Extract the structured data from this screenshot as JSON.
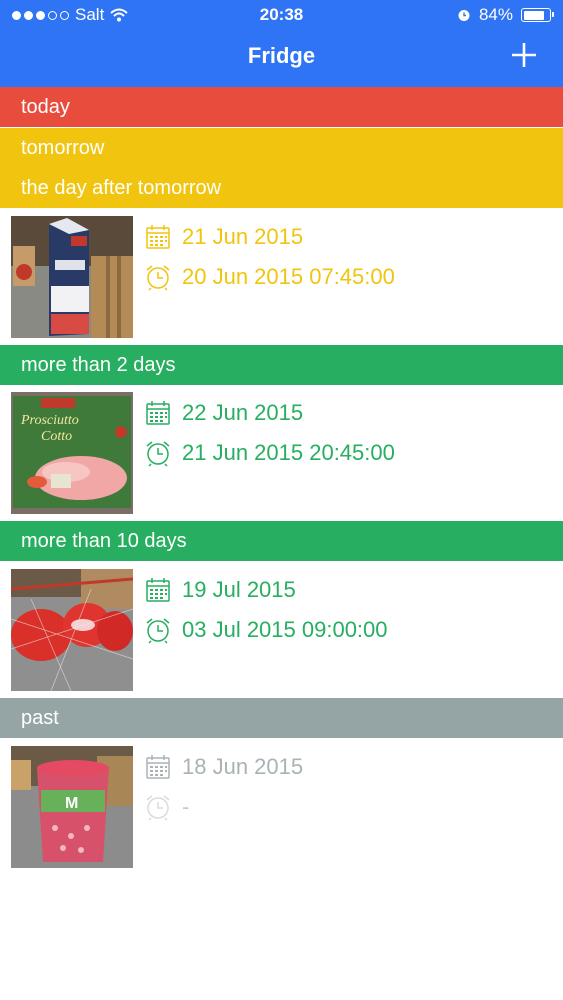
{
  "status_bar": {
    "carrier": "Salt",
    "time": "20:38",
    "battery": "84%",
    "battery_level": 0.84
  },
  "nav": {
    "title": "Fridge",
    "add_icon": "plus-icon"
  },
  "colors": {
    "header": "#2f74f4",
    "today": "#e84c3d",
    "soon": "#f1c40f",
    "fresh": "#27ae60",
    "past": "#95a5a6",
    "past_icon": "#c5cbcc"
  },
  "sections": {
    "today": "today",
    "tomorrow": "tomorrow",
    "day_after": "the day after tomorrow",
    "more_2": "more than 2 days",
    "more_10": "more than 10 days",
    "past": "past"
  },
  "items": [
    {
      "thumb": "milk carton",
      "date": "21 Jun 2015",
      "reminder": "20 Jun 2015 07:45:00"
    },
    {
      "thumb": "Prosciutto Cotto package",
      "date": "22 Jun 2015",
      "reminder": "21 Jun 2015 20:45:00"
    },
    {
      "thumb": "Babybel cheese net",
      "date": "19 Jul 2015",
      "reminder": "03 Jul 2015 09:00:00"
    },
    {
      "thumb": "yogurt cup",
      "date": "18 Jun 2015",
      "reminder": "-"
    }
  ]
}
